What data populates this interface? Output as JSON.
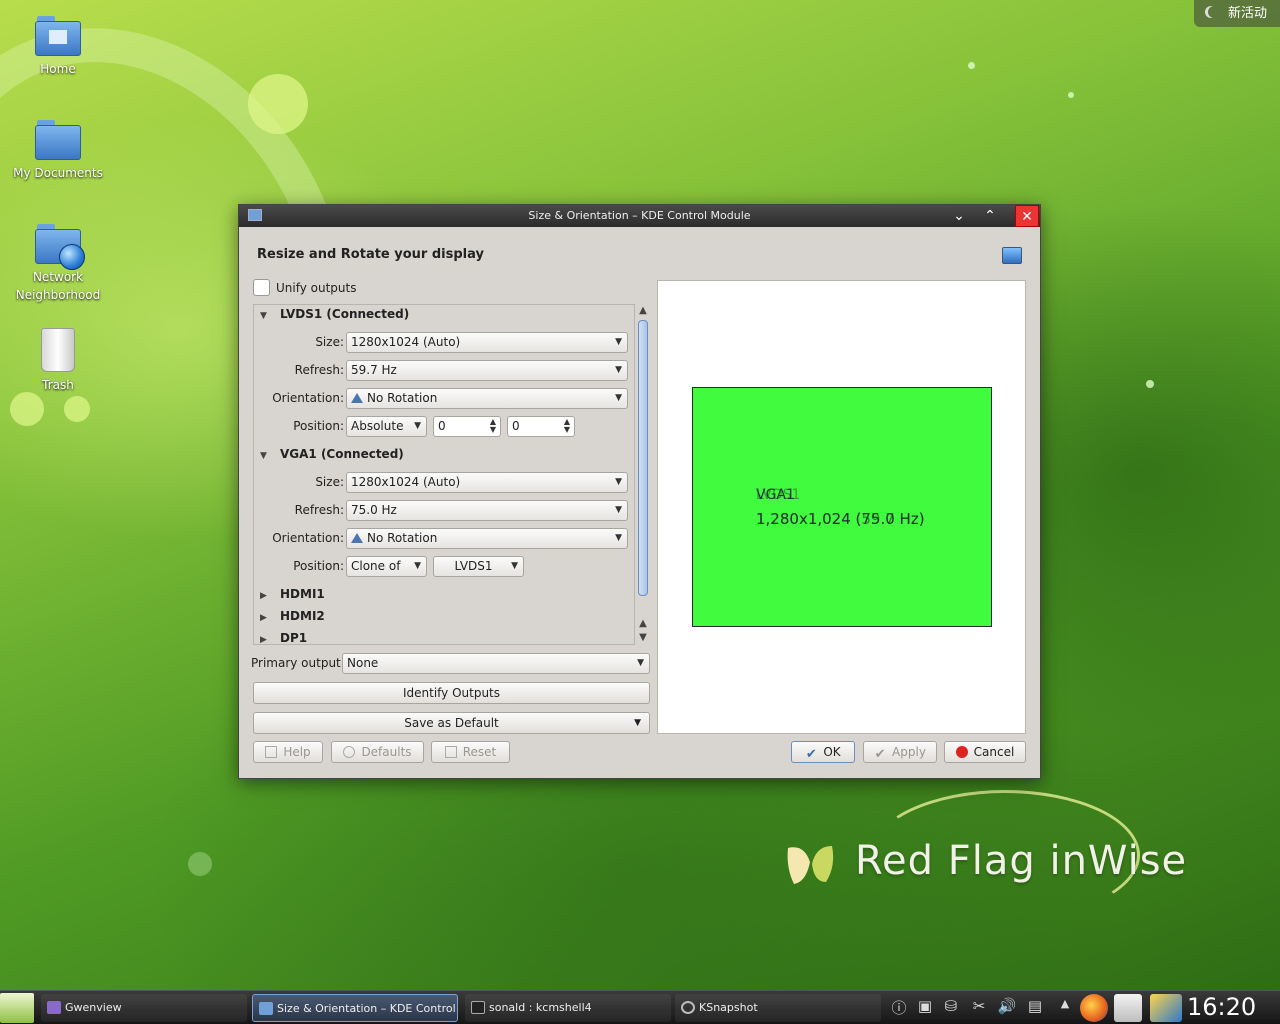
{
  "desktop": {
    "activity_label": "新活动",
    "icons": [
      {
        "label": "Home"
      },
      {
        "label": "My Documents"
      },
      {
        "label": "Network Neighborhood",
        "line1": "Network",
        "line2": "Neighborhood"
      },
      {
        "label": "Trash"
      }
    ],
    "brand": "Red Flag inWise"
  },
  "window": {
    "title": "Size & Orientation – KDE Control Module",
    "heading": "Resize and Rotate your display",
    "unify_label": "Unify outputs",
    "unify_checked": false,
    "outputs": [
      {
        "name": "LVDS1 (Connected)",
        "expanded": true,
        "size_label": "Size:",
        "size": "1280x1024 (Auto)",
        "refresh_label": "Refresh:",
        "refresh": "59.7 Hz",
        "orientation_label": "Orientation:",
        "orientation": "No Rotation",
        "position_label": "Position:",
        "position_mode": "Absolute",
        "x": "0",
        "y": "0"
      },
      {
        "name": "VGA1 (Connected)",
        "expanded": true,
        "size_label": "Size:",
        "size": "1280x1024 (Auto)",
        "refresh_label": "Refresh:",
        "refresh": "75.0 Hz",
        "orientation_label": "Orientation:",
        "orientation": "No Rotation",
        "position_label": "Position:",
        "position_mode": "Clone of",
        "clone_target": "LVDS1"
      },
      {
        "name": "HDMI1",
        "expanded": false
      },
      {
        "name": "HDMI2",
        "expanded": false
      },
      {
        "name": "DP1",
        "expanded": false
      }
    ],
    "primary_label": "Primary output:",
    "primary_value": "None",
    "identify_label": "Identify Outputs",
    "save_default_label": "Save as Default",
    "preview": {
      "name_front": "VGA1",
      "name_back": "LVDS1",
      "resolution_front": "1,280x1,024 (75.0 Hz)",
      "resolution_back": "1,280x1,024 (59.7 Hz)",
      "screen_color": "#41fb3e"
    },
    "buttons": {
      "help": "Help",
      "defaults": "Defaults",
      "reset": "Reset",
      "ok": "OK",
      "apply": "Apply",
      "cancel": "Cancel"
    }
  },
  "taskbar": {
    "tasks": [
      {
        "label": "Gwenview",
        "active": false
      },
      {
        "label": "Size & Orientation – KDE Control",
        "active": true
      },
      {
        "label": "sonald : kcmshell4",
        "active": false
      },
      {
        "label": "KSnapshot",
        "active": false
      }
    ],
    "clock": "16:20"
  },
  "colors": {
    "accent": "#4a76b0",
    "close": "#e33333",
    "wallpaper": "#5ba42a"
  }
}
